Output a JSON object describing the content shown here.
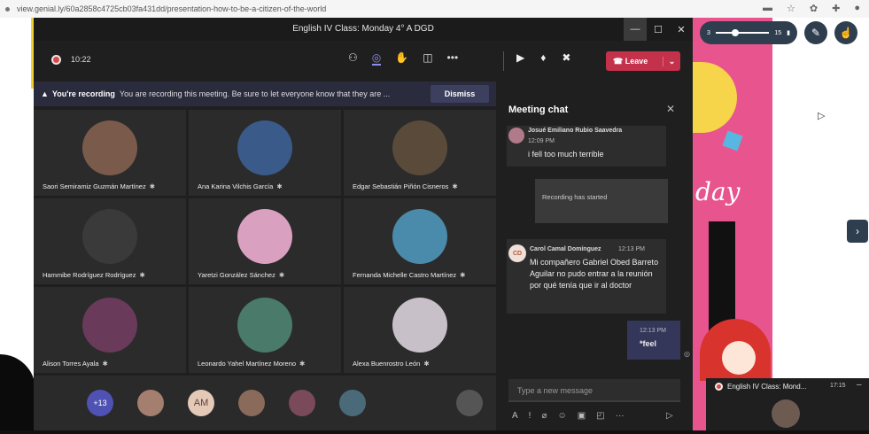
{
  "browser": {
    "url": "view.genial.ly/60a2858c4725cb03fa431dd/presentation-how-to-be-a-citizen-of-the-world",
    "icons": [
      "minus-icon",
      "star-icon",
      "extension-icon",
      "puzzle-icon",
      "profile-icon"
    ]
  },
  "presentation": {
    "zoom_min": "3",
    "zoom_max": "15",
    "art_text": "day"
  },
  "teams": {
    "window_title": "English IV Class: Monday 4° A DGD",
    "timer": "10:22",
    "leave_label": "Leave",
    "banner": {
      "title": "You're recording",
      "message": "You are recording this meeting. Be sure to let everyone know that they are ...",
      "dismiss_label": "Dismiss"
    },
    "participants": [
      {
        "name": "Saori Semiramiz Guzmán Martínez",
        "color": "#7a5a4a"
      },
      {
        "name": "Ana Karina Vilchis García",
        "color": "#3a5a8a"
      },
      {
        "name": "Edgar Sebastián Piñón Cisneros",
        "color": "#5a4a3a"
      },
      {
        "name": "Hammibe Rodríguez Rodríguez",
        "color": "#3a3a3a"
      },
      {
        "name": "Yaretzi González Sánchez",
        "color": "#d9a0c0"
      },
      {
        "name": "Fernanda Michelle Castro Martínez",
        "color": "#4a8aaa"
      },
      {
        "name": "Alison Torres Ayala",
        "color": "#6a3a5a"
      },
      {
        "name": "Leonardo Yahel Martínez Moreno",
        "color": "#4a7a6a"
      },
      {
        "name": "Alexa Buenrostro León",
        "color": "#c8c0c8"
      }
    ],
    "roster": {
      "overflow": "+13",
      "initials": "AM"
    },
    "chat": {
      "title": "Meeting chat",
      "message1": {
        "author": "Josué Emiliano Rubio Saavedra",
        "time": "12:09 PM",
        "text": "i fell too much terrible"
      },
      "system": "Recording has started",
      "message2": {
        "initials": "CD",
        "author": "Carol Camal Domínguez",
        "time": "12:13 PM",
        "text": "Mi compañero Gabriel Obed Barreto Aguilar no pudo entrar a la reunión por qué tenía que ir al doctor"
      },
      "mine": {
        "time": "12:13 PM",
        "text": "*feel"
      },
      "input_placeholder": "Type a new message"
    }
  },
  "mini_window": {
    "title": "English IV Class: Mond...",
    "time": "17:15"
  }
}
